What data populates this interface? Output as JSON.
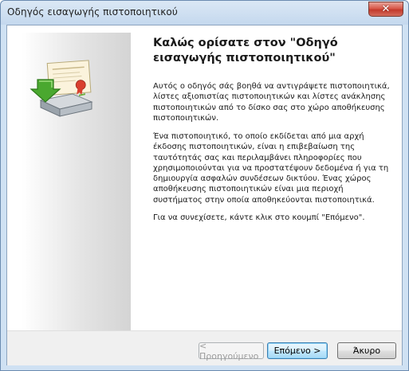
{
  "window": {
    "title": "Οδηγός εισαγωγής πιστοποιητικού",
    "close_symbol": "✕"
  },
  "content": {
    "heading": "Καλώς ορίσατε στον \"Οδηγό εισαγωγής πιστοποιητικού\"",
    "paragraph1": "Αυτός ο οδηγός σάς βοηθά να αντιγράψετε πιστοποιητικά, λίστες αξιοπιστίας πιστοποιητικών και λίστες ανάκλησης πιστοποιητικών από το δίσκο σας στο χώρο αποθήκευσης πιστοποιητικών.",
    "paragraph2": "Ένα πιστοποιητικό, το οποίο εκδίδεται από μια αρχή έκδοσης πιστοποιητικών, είναι η επιβεβαίωση της ταυτότητάς σας και περιλαμβάνει πληροφορίες που χρησιμοποιούνται για να προστατέψουν δεδομένα ή για τη δημιουργία ασφαλών συνδέσεων δικτύου. Ένας χώρος αποθήκευσης πιστοποιητικών είναι μια περιοχή συστήματος στην οποία αποθηκεύονται πιστοποιητικά.",
    "paragraph3": "Για να συνεχίσετε, κάντε κλικ στο κουμπί \"Επόμενο\"."
  },
  "footer": {
    "back_label": "< Προηγούμενο",
    "next_label": "Επόμενο >",
    "cancel_label": "Άκυρο"
  },
  "icons": {
    "wizard_graphic": "certificate-import-icon",
    "close": "close-icon"
  },
  "colors": {
    "title_bar": "#c4d8ee",
    "close_button": "#c33a2c",
    "next_button_border": "#3c7fb1",
    "footer_background": "#f0f0f0"
  }
}
